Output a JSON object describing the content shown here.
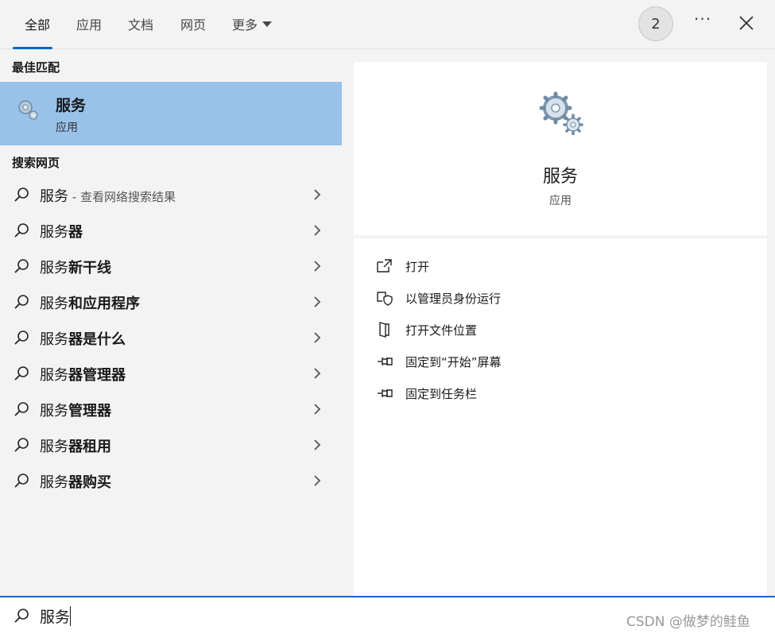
{
  "tabs": [
    {
      "label": "全部"
    },
    {
      "label": "应用"
    },
    {
      "label": "文档"
    },
    {
      "label": "网页"
    },
    {
      "label": "更多"
    }
  ],
  "header": {
    "badge_count": "2",
    "more_options": "···"
  },
  "best_match": {
    "heading": "最佳匹配",
    "title": "服务",
    "subtitle": "应用"
  },
  "web_search": {
    "heading": "搜索网页",
    "items": [
      {
        "base": "服务",
        "suffix": "",
        "hint": " - 查看网络搜索结果"
      },
      {
        "base": "服务",
        "suffix": "器",
        "hint": ""
      },
      {
        "base": "服务",
        "suffix": "新干线",
        "hint": ""
      },
      {
        "base": "服务",
        "suffix": "和应用程序",
        "hint": ""
      },
      {
        "base": "服务",
        "suffix": "器是什么",
        "hint": ""
      },
      {
        "base": "服务",
        "suffix": "器管理器",
        "hint": ""
      },
      {
        "base": "服务",
        "suffix": "管理器",
        "hint": ""
      },
      {
        "base": "服务",
        "suffix": "器租用",
        "hint": ""
      },
      {
        "base": "服务",
        "suffix": "器购买",
        "hint": ""
      }
    ]
  },
  "detail": {
    "title": "服务",
    "subtitle": "应用",
    "actions": [
      {
        "label": "打开",
        "icon": "open-window-icon"
      },
      {
        "label": "以管理员身份运行",
        "icon": "shield-icon"
      },
      {
        "label": "打开文件位置",
        "icon": "folder-icon"
      },
      {
        "label": "固定到“开始”屏幕",
        "icon": "pin-icon"
      },
      {
        "label": "固定到任务栏",
        "icon": "pin-icon"
      }
    ]
  },
  "search": {
    "value": "服务",
    "watermark": "CSDN @做梦的鲑鱼"
  },
  "colors": {
    "accent": "#0067c0",
    "selected": "#98c2ea"
  }
}
